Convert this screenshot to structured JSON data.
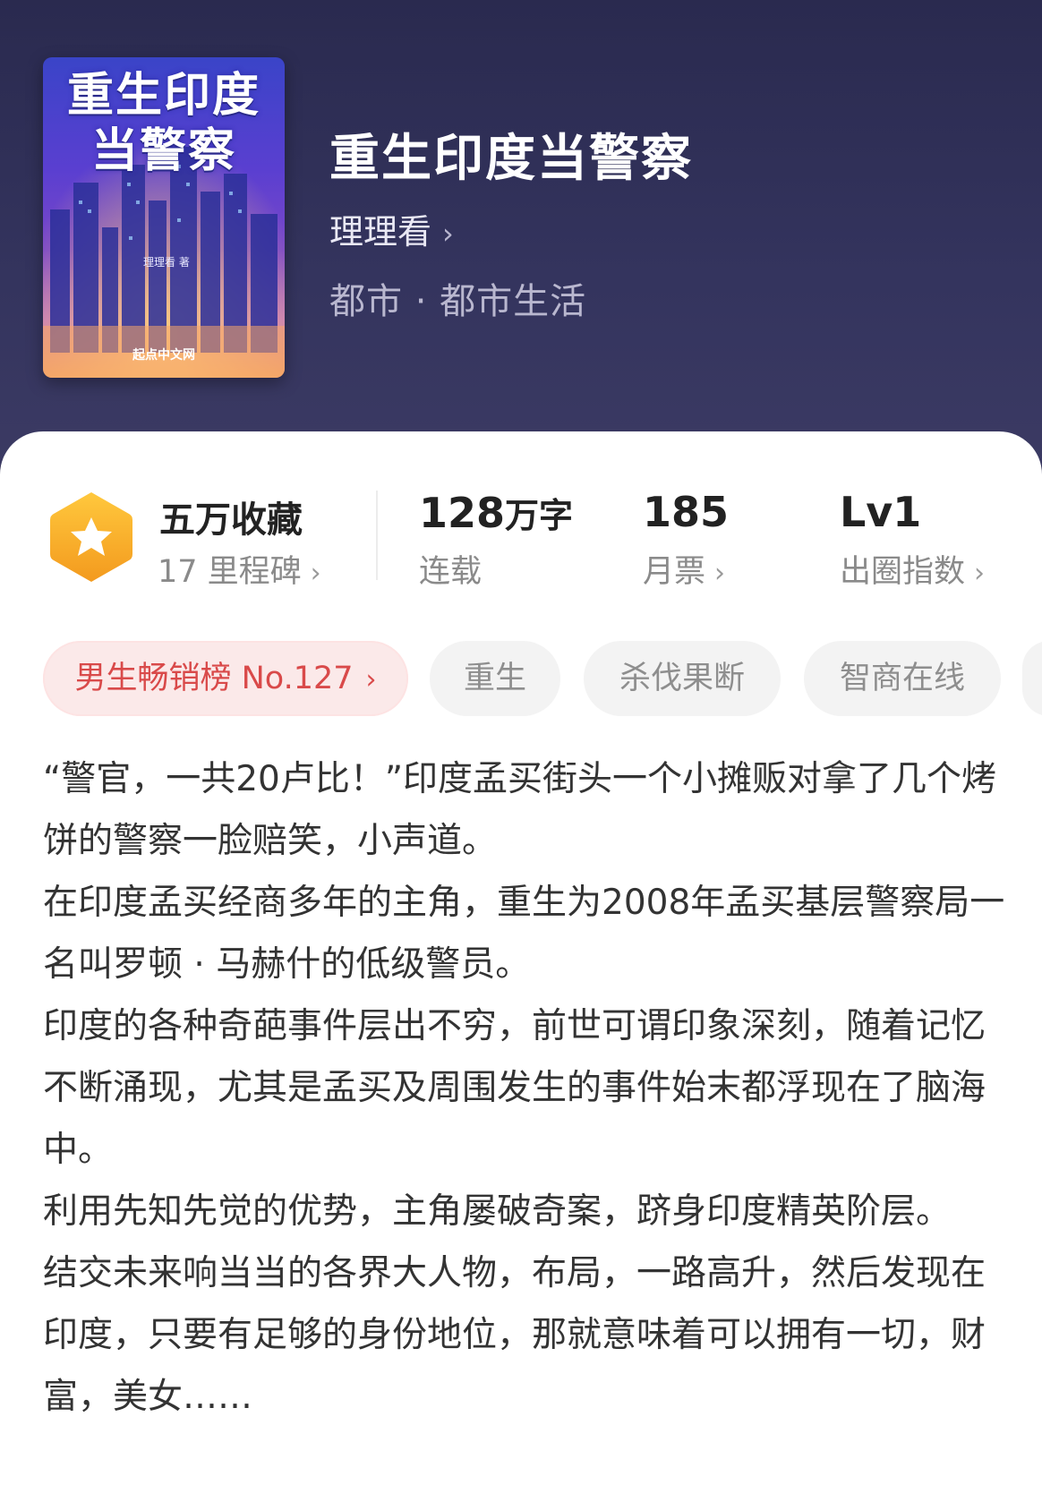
{
  "book": {
    "cover_title_line1": "重生印度",
    "cover_title_line2": "当警察",
    "cover_author": "理理看 著",
    "cover_publisher": "起点中文网",
    "title": "重生印度当警察",
    "author": "理理看",
    "genre": "都市 · 都市生活"
  },
  "stats": {
    "favorites": "五万收藏",
    "milestones": "17 里程碑",
    "word_count_value": "128",
    "word_count_unit": "万字",
    "status": "连载",
    "monthly_votes_value": "185",
    "monthly_votes_label": "月票",
    "level_value": "Lv1",
    "level_label": "出圈指数"
  },
  "tags": [
    {
      "label": "男生畅销榜 No.127",
      "type": "rank"
    },
    {
      "label": "重生",
      "type": "normal"
    },
    {
      "label": "杀伐果断",
      "type": "normal"
    },
    {
      "label": "智商在线",
      "type": "normal"
    }
  ],
  "synopsis": [
    "“警官，一共20卢比！”印度孟买街头一个小摊贩对拿了几个烤饼的警察一脸赔笑，小声道。",
    "在印度孟买经商多年的主角，重生为2008年孟买基层警察局一名叫罗顿 · 马赫什的低级警员。",
    "印度的各种奇葩事件层出不穷，前世可谓印象深刻，随着记忆不断涌现，尤其是孟买及周围发生的事件始末都浮现在了脑海中。",
    "利用先知先觉的优势，主角屡破奇案，跻身印度精英阶层。",
    "结交未来响当当的各界大人物，布局，一路高升，然后发现在印度，只要有足够的身份地位，那就意味着可以拥有一切，财富，美女……"
  ],
  "colors": {
    "header_bg": "#2d2c50",
    "badge_orange": "#f6a623",
    "rank_tag_bg": "#fbe9e9",
    "rank_tag_text": "#d94a4a"
  },
  "icons": [
    "chevron-right-icon",
    "star-badge-icon"
  ]
}
